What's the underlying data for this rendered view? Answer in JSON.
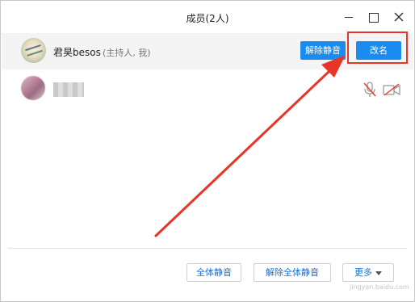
{
  "window": {
    "title": "成员(2人)"
  },
  "host": {
    "name": "君昊besos",
    "role": "(主持人, 我)",
    "unmute_label": "解除静音",
    "rename_label": "改名"
  },
  "member": {
    "name": "",
    "mic_state": "muted",
    "camera_state": "off"
  },
  "footer": {
    "mute_all_label": "全体静音",
    "unmute_all_label": "解除全体静音",
    "more_label": "更多"
  },
  "watermark": {
    "site": "jingyan.baidu.com"
  },
  "colors": {
    "accent": "#1a8cf0",
    "annotation": "#e8352a",
    "host_row_bg": "#f4f4f4"
  }
}
